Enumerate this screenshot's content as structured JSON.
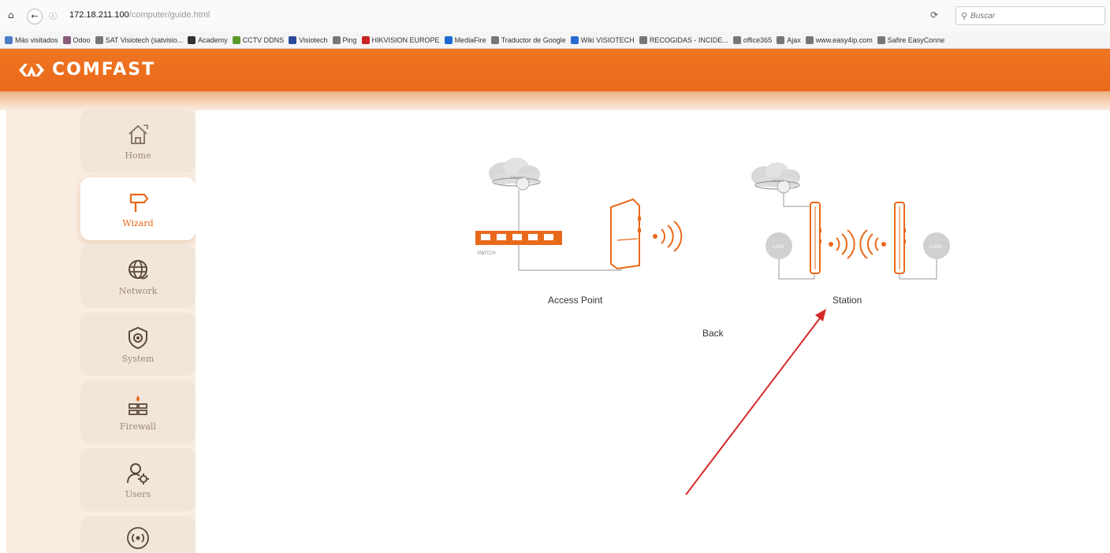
{
  "browser": {
    "url_host": "172.18.211.100",
    "url_path": "/computer/guide.html",
    "search_placeholder": "Buscar",
    "bookmarks": [
      {
        "label": "Más visitados",
        "color": "#4a7ec9"
      },
      {
        "label": "Odoo",
        "color": "#875a7b"
      },
      {
        "label": "SAT Visiotech (satvisio...",
        "color": "#777777"
      },
      {
        "label": "Academy",
        "color": "#333333"
      },
      {
        "label": "CCTV DDNS",
        "color": "#5a9a2a"
      },
      {
        "label": "Visiotech",
        "color": "#2a4a9a"
      },
      {
        "label": "Ping",
        "color": "#777777"
      },
      {
        "label": "HIKVISION EUROPE",
        "color": "#cc2222"
      },
      {
        "label": "MediaFire",
        "color": "#1a6ad0"
      },
      {
        "label": "Traductor de Google",
        "color": "#777777"
      },
      {
        "label": "Wiki VISIOTECH",
        "color": "#2a6ad0"
      },
      {
        "label": "RECOGIDAS - INCIDE...",
        "color": "#777777"
      },
      {
        "label": "office365",
        "color": "#777777"
      },
      {
        "label": "Ajax",
        "color": "#777777"
      },
      {
        "label": "www.easy4ip.com",
        "color": "#777777"
      },
      {
        "label": "Safire EasyConne",
        "color": "#777777"
      }
    ]
  },
  "header": {
    "logo_text": "COMFAST",
    "brand_color": "#e9691a"
  },
  "sidebar": {
    "items": [
      {
        "label": "Home",
        "icon": "home-icon"
      },
      {
        "label": "Wizard",
        "icon": "signpost-icon",
        "active": true
      },
      {
        "label": "Network",
        "icon": "globe-network-icon"
      },
      {
        "label": "System",
        "icon": "shield-gear-icon"
      },
      {
        "label": "Firewall",
        "icon": "firewall-icon"
      },
      {
        "label": "Users",
        "icon": "users-icon"
      },
      {
        "label": "",
        "icon": "wireless-icon"
      }
    ]
  },
  "main": {
    "access_point_label": "Access Point",
    "station_label": "Station",
    "back_label": "Back",
    "switch_label": "SWITCH",
    "internet_label": "Internet",
    "lan1_label": "LAN1",
    "lan2_label": "LAN2"
  },
  "annotation": {
    "arrow_color": "#d62a2a"
  }
}
